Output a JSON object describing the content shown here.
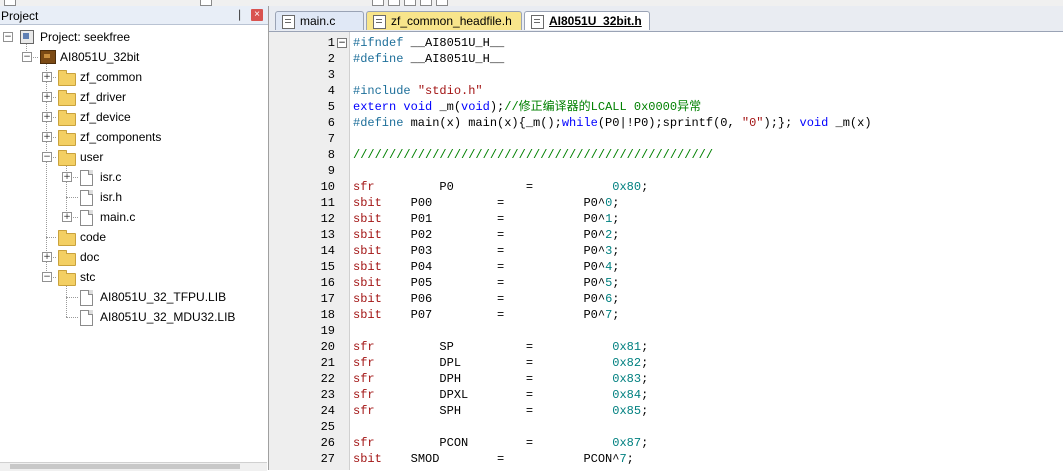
{
  "panel": {
    "title": "Project",
    "pin": "❘",
    "close": "×"
  },
  "tree": [
    {
      "label": "Project: seekfree",
      "level": 0,
      "icon": "project-icon",
      "expander": "−",
      "kind": "project"
    },
    {
      "label": "AI8051U_32bit",
      "level": 1,
      "icon": "target-icon",
      "expander": "−",
      "kind": "target"
    },
    {
      "label": "zf_common",
      "level": 2,
      "icon": "folder-icon",
      "expander": "+",
      "kind": "group"
    },
    {
      "label": "zf_driver",
      "level": 2,
      "icon": "folder-icon",
      "expander": "+",
      "kind": "group"
    },
    {
      "label": "zf_device",
      "level": 2,
      "icon": "folder-icon",
      "expander": "+",
      "kind": "group"
    },
    {
      "label": "zf_components",
      "level": 2,
      "icon": "folder-icon",
      "expander": "+",
      "kind": "group"
    },
    {
      "label": "user",
      "level": 2,
      "icon": "folder-icon",
      "expander": "−",
      "kind": "group"
    },
    {
      "label": "isr.c",
      "level": 3,
      "icon": "file-icon",
      "expander": "+",
      "kind": "file"
    },
    {
      "label": "isr.h",
      "level": 3,
      "icon": "file-icon",
      "expander": "",
      "kind": "file"
    },
    {
      "label": "main.c",
      "level": 3,
      "icon": "file-icon",
      "expander": "+",
      "kind": "file"
    },
    {
      "label": "code",
      "level": 2,
      "icon": "folder-icon",
      "expander": "",
      "kind": "group"
    },
    {
      "label": "doc",
      "level": 2,
      "icon": "folder-icon",
      "expander": "+",
      "kind": "group"
    },
    {
      "label": "stc",
      "level": 2,
      "icon": "folder-icon",
      "expander": "−",
      "kind": "group"
    },
    {
      "label": "AI8051U_32_TFPU.LIB",
      "level": 3,
      "icon": "file-icon",
      "expander": "",
      "kind": "file"
    },
    {
      "label": "AI8051U_32_MDU32.LIB",
      "level": 3,
      "icon": "file-icon",
      "expander": "",
      "kind": "file"
    }
  ],
  "tabs": [
    {
      "label": "main.c",
      "id": "tab-main"
    },
    {
      "label": "zf_common_headfile.h",
      "id": "tab-zf"
    },
    {
      "label": "AI8051U_32bit.h",
      "id": "tab-ai"
    }
  ],
  "editor": {
    "lines": [
      {
        "n": "1",
        "fold": "−",
        "tokens": [
          [
            "pre",
            "#ifndef "
          ],
          [
            "id",
            "__AI8051U_H__"
          ]
        ]
      },
      {
        "n": "2",
        "tokens": [
          [
            "pre",
            "#define "
          ],
          [
            "id",
            "__AI8051U_H__"
          ]
        ]
      },
      {
        "n": "3",
        "tokens": []
      },
      {
        "n": "4",
        "tokens": [
          [
            "pre",
            "#include "
          ],
          [
            "str",
            "\"stdio.h\""
          ]
        ]
      },
      {
        "n": "5",
        "tokens": [
          [
            "kw",
            "extern "
          ],
          [
            "kw",
            "void "
          ],
          [
            "id",
            "_m("
          ],
          [
            "kw",
            "void"
          ],
          [
            "id",
            ");"
          ],
          [
            "cmt",
            "//修正编译器的LCALL 0x0000异常"
          ]
        ]
      },
      {
        "n": "6",
        "tokens": [
          [
            "pre",
            "#define "
          ],
          [
            "id",
            "main(x) main(x){_m();"
          ],
          [
            "kw",
            "while"
          ],
          [
            "id",
            "(P0|!P0);sprintf(0, "
          ],
          [
            "str",
            "\"0\""
          ],
          [
            "id",
            ");}; "
          ],
          [
            "kw",
            "void "
          ],
          [
            "id",
            "_m(x)"
          ]
        ]
      },
      {
        "n": "7",
        "tokens": []
      },
      {
        "n": "8",
        "tokens": [
          [
            "cmt",
            "//////////////////////////////////////////////////"
          ]
        ]
      },
      {
        "n": "9",
        "tokens": []
      },
      {
        "n": "10",
        "tokens": [
          [
            "typ",
            "sfr"
          ],
          [
            "id",
            "         P0          =           "
          ],
          [
            "num",
            "0x80"
          ],
          [
            "id",
            ";"
          ]
        ]
      },
      {
        "n": "11",
        "tokens": [
          [
            "typ",
            "sbit"
          ],
          [
            "id",
            "    P00         =           P0^"
          ],
          [
            "num",
            "0"
          ],
          [
            "id",
            ";"
          ]
        ]
      },
      {
        "n": "12",
        "tokens": [
          [
            "typ",
            "sbit"
          ],
          [
            "id",
            "    P01         =           P0^"
          ],
          [
            "num",
            "1"
          ],
          [
            "id",
            ";"
          ]
        ]
      },
      {
        "n": "13",
        "tokens": [
          [
            "typ",
            "sbit"
          ],
          [
            "id",
            "    P02         =           P0^"
          ],
          [
            "num",
            "2"
          ],
          [
            "id",
            ";"
          ]
        ]
      },
      {
        "n": "14",
        "tokens": [
          [
            "typ",
            "sbit"
          ],
          [
            "id",
            "    P03         =           P0^"
          ],
          [
            "num",
            "3"
          ],
          [
            "id",
            ";"
          ]
        ]
      },
      {
        "n": "15",
        "tokens": [
          [
            "typ",
            "sbit"
          ],
          [
            "id",
            "    P04         =           P0^"
          ],
          [
            "num",
            "4"
          ],
          [
            "id",
            ";"
          ]
        ]
      },
      {
        "n": "16",
        "tokens": [
          [
            "typ",
            "sbit"
          ],
          [
            "id",
            "    P05         =           P0^"
          ],
          [
            "num",
            "5"
          ],
          [
            "id",
            ";"
          ]
        ]
      },
      {
        "n": "17",
        "tokens": [
          [
            "typ",
            "sbit"
          ],
          [
            "id",
            "    P06         =           P0^"
          ],
          [
            "num",
            "6"
          ],
          [
            "id",
            ";"
          ]
        ]
      },
      {
        "n": "18",
        "tokens": [
          [
            "typ",
            "sbit"
          ],
          [
            "id",
            "    P07         =           P0^"
          ],
          [
            "num",
            "7"
          ],
          [
            "id",
            ";"
          ]
        ]
      },
      {
        "n": "19",
        "tokens": []
      },
      {
        "n": "20",
        "tokens": [
          [
            "typ",
            "sfr"
          ],
          [
            "id",
            "         SP          =           "
          ],
          [
            "num",
            "0x81"
          ],
          [
            "id",
            ";"
          ]
        ]
      },
      {
        "n": "21",
        "tokens": [
          [
            "typ",
            "sfr"
          ],
          [
            "id",
            "         DPL         =           "
          ],
          [
            "num",
            "0x82"
          ],
          [
            "id",
            ";"
          ]
        ]
      },
      {
        "n": "22",
        "tokens": [
          [
            "typ",
            "sfr"
          ],
          [
            "id",
            "         DPH         =           "
          ],
          [
            "num",
            "0x83"
          ],
          [
            "id",
            ";"
          ]
        ]
      },
      {
        "n": "23",
        "tokens": [
          [
            "typ",
            "sfr"
          ],
          [
            "id",
            "         DPXL        =           "
          ],
          [
            "num",
            "0x84"
          ],
          [
            "id",
            ";"
          ]
        ]
      },
      {
        "n": "24",
        "tokens": [
          [
            "typ",
            "sfr"
          ],
          [
            "id",
            "         SPH         =           "
          ],
          [
            "num",
            "0x85"
          ],
          [
            "id",
            ";"
          ]
        ]
      },
      {
        "n": "25",
        "tokens": []
      },
      {
        "n": "26",
        "tokens": [
          [
            "typ",
            "sfr"
          ],
          [
            "id",
            "         PCON        =           "
          ],
          [
            "num",
            "0x87"
          ],
          [
            "id",
            ";"
          ]
        ]
      },
      {
        "n": "27",
        "tokens": [
          [
            "typ",
            "sbit"
          ],
          [
            "id",
            "    SMOD        =           PCON^"
          ],
          [
            "num",
            "7"
          ],
          [
            "id",
            ";"
          ]
        ]
      }
    ]
  }
}
